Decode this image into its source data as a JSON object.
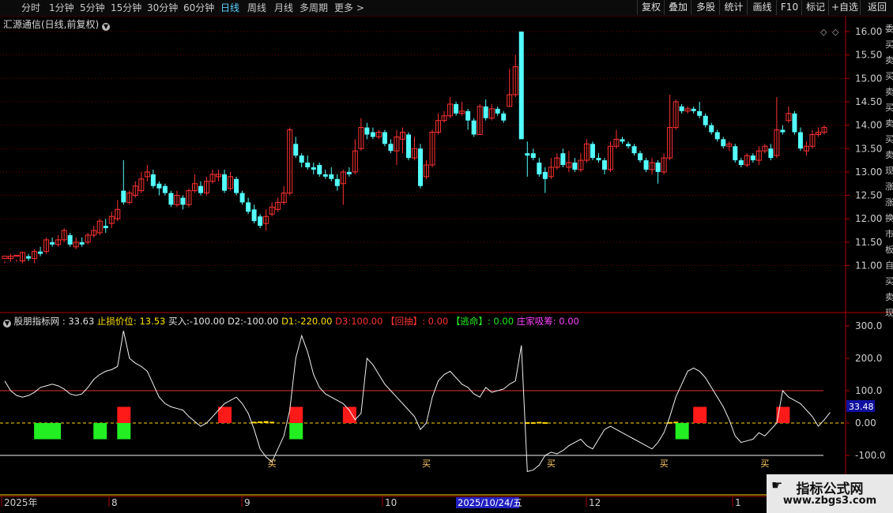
{
  "toolbar": {
    "periods": [
      "分时",
      "1分钟",
      "5分钟",
      "15分钟",
      "30分钟",
      "60分钟",
      "日线",
      "周线",
      "月线",
      "多周期",
      "更多 >"
    ],
    "active_period": "日线",
    "buttons": [
      "复权",
      "叠加",
      "多股",
      "统计",
      "画线",
      "F10",
      "标记",
      "+自选",
      "返回"
    ]
  },
  "main_chart": {
    "title": "汇源通信(日线,前复权)",
    "price_ticks": [
      "16.00",
      "15.50",
      "15.00",
      "14.50",
      "14.00",
      "13.50",
      "13.00",
      "12.50",
      "12.00",
      "11.50",
      "11.00"
    ]
  },
  "indicator": {
    "name": "股朋指标网",
    "value": ": 33.63",
    "stop_label": "止损价位:",
    "stop_value": "13.53",
    "buy_label": "买入:",
    "buy_value": "-100.00",
    "d2": "D2:-100.00",
    "d1": "D1:-220.00",
    "d3": "D3:100.00",
    "huichou_label": "【回抽】",
    "huichou_value": ": 0.00",
    "taoming_label": "【逃命】",
    "taoming_value": ": 0.00",
    "zhuangjia_label": "庄家吸筹:",
    "zhuangjia_value": "0.00",
    "ticks": [
      "300.0",
      "200.0",
      "100.0",
      "0.00",
      "-100.0"
    ],
    "current_badge": "33.48",
    "buy_marker": "买"
  },
  "date_axis": {
    "labels": [
      "2025年",
      "8",
      "9",
      "10",
      "12",
      "1"
    ],
    "cursor_date": "2025/10/24/五"
  },
  "side_text": [
    "委",
    "买",
    "卖",
    "买",
    "卖",
    "买",
    "卖",
    "买",
    "卖",
    "现",
    "涨",
    "涨",
    "换",
    "市",
    "板",
    "自",
    "买",
    "卖",
    "现"
  ],
  "watermark": {
    "line1": "指标公式网",
    "line2": "www.zbgs3.com"
  },
  "colors": {
    "up": "#ff3232",
    "down": "#54ffff",
    "background": "#000000",
    "grid": "#7a0000",
    "axis": "#b00000",
    "signal_red": "#ff1a1a",
    "signal_green": "#22ee22",
    "yellow": "#ffd700"
  },
  "chart_data": {
    "type": "candlestick",
    "candles": [
      [
        11.15,
        11.2,
        11.1,
        11.05
      ],
      [
        11.15,
        11.2,
        11.25,
        11.08
      ],
      [
        11.2,
        11.22,
        11.13,
        11.08
      ],
      [
        11.1,
        11.28,
        11.3,
        11.05
      ],
      [
        11.2,
        11.15,
        11.25,
        11.1
      ],
      [
        11.15,
        11.3,
        11.35,
        11.05
      ],
      [
        11.3,
        11.25,
        11.4,
        11.2
      ],
      [
        11.3,
        11.55,
        11.6,
        11.25
      ],
      [
        11.5,
        11.45,
        11.6,
        11.4
      ],
      [
        11.45,
        11.55,
        11.65,
        11.4
      ],
      [
        11.55,
        11.75,
        11.8,
        11.5
      ],
      [
        11.65,
        11.45,
        11.7,
        11.4
      ],
      [
        11.4,
        11.5,
        11.6,
        11.35
      ],
      [
        11.5,
        11.45,
        11.6,
        11.4
      ],
      [
        11.5,
        11.65,
        11.7,
        11.45
      ],
      [
        11.65,
        11.75,
        11.85,
        11.6
      ],
      [
        11.7,
        11.95,
        12.0,
        11.65
      ],
      [
        11.85,
        11.8,
        12.0,
        11.7
      ],
      [
        11.9,
        12.05,
        12.15,
        11.8
      ],
      [
        12.0,
        12.2,
        12.4,
        11.95
      ],
      [
        12.6,
        12.35,
        13.25,
        12.3
      ],
      [
        12.35,
        12.55,
        12.6,
        12.3
      ],
      [
        12.5,
        12.7,
        12.8,
        12.45
      ],
      [
        12.6,
        12.85,
        13.0,
        12.55
      ],
      [
        12.9,
        13.0,
        13.15,
        12.8
      ],
      [
        12.95,
        12.7,
        13.05,
        12.65
      ],
      [
        12.75,
        12.65,
        12.8,
        12.5
      ],
      [
        12.7,
        12.55,
        12.75,
        12.5
      ],
      [
        12.55,
        12.3,
        12.6,
        12.25
      ],
      [
        12.3,
        12.5,
        12.6,
        12.25
      ],
      [
        12.45,
        12.3,
        12.5,
        12.2
      ],
      [
        12.3,
        12.6,
        12.65,
        12.25
      ],
      [
        12.6,
        12.75,
        12.95,
        12.55
      ],
      [
        12.7,
        12.55,
        12.8,
        12.5
      ],
      [
        12.55,
        12.8,
        12.9,
        12.5
      ],
      [
        12.8,
        12.95,
        13.05,
        12.75
      ],
      [
        12.9,
        12.95,
        13.05,
        12.8
      ],
      [
        12.95,
        12.6,
        13.05,
        12.55
      ],
      [
        12.65,
        12.9,
        13.0,
        12.6
      ],
      [
        12.85,
        12.55,
        12.9,
        12.5
      ],
      [
        12.55,
        12.35,
        12.6,
        12.3
      ],
      [
        12.35,
        12.15,
        12.45,
        12.1
      ],
      [
        12.2,
        11.95,
        12.3,
        11.9
      ],
      [
        12.05,
        11.85,
        12.1,
        11.8
      ],
      [
        11.9,
        12.05,
        12.2,
        11.75
      ],
      [
        12.1,
        12.25,
        12.35,
        12.05
      ],
      [
        12.2,
        12.35,
        12.45,
        12.15
      ],
      [
        12.35,
        12.55,
        12.7,
        12.3
      ],
      [
        12.55,
        13.9,
        13.95,
        12.5
      ],
      [
        13.6,
        13.35,
        13.75,
        13.3
      ],
      [
        13.35,
        13.2,
        13.4,
        13.1
      ],
      [
        13.2,
        13.1,
        13.35,
        13.05
      ],
      [
        13.1,
        13.05,
        13.2,
        12.95
      ],
      [
        13.15,
        12.95,
        13.2,
        12.9
      ],
      [
        12.95,
        12.9,
        13.05,
        12.85
      ],
      [
        12.95,
        12.85,
        13.1,
        12.8
      ],
      [
        12.85,
        12.7,
        12.95,
        12.6
      ],
      [
        12.75,
        13.0,
        13.05,
        12.3
      ],
      [
        13.0,
        12.95,
        13.1,
        12.9
      ],
      [
        13.0,
        13.45,
        13.7,
        12.95
      ],
      [
        13.5,
        13.95,
        14.15,
        13.45
      ],
      [
        13.95,
        13.8,
        14.05,
        13.7
      ],
      [
        13.85,
        13.75,
        13.95,
        13.7
      ],
      [
        13.75,
        13.85,
        13.9,
        13.7
      ],
      [
        13.85,
        13.6,
        13.9,
        13.55
      ],
      [
        13.6,
        13.45,
        13.7,
        13.4
      ],
      [
        13.45,
        13.75,
        13.9,
        13.15
      ],
      [
        13.7,
        13.85,
        13.95,
        13.4
      ],
      [
        13.8,
        13.3,
        13.85,
        13.25
      ],
      [
        13.3,
        13.5,
        13.75,
        13.25
      ],
      [
        13.5,
        12.7,
        13.6,
        12.65
      ],
      [
        12.9,
        13.15,
        13.25,
        12.85
      ],
      [
        13.15,
        13.85,
        13.9,
        13.1
      ],
      [
        13.85,
        14.1,
        14.25,
        13.8
      ],
      [
        14.1,
        14.2,
        14.3,
        14.05
      ],
      [
        14.2,
        14.45,
        14.6,
        14.15
      ],
      [
        14.45,
        14.25,
        14.5,
        14.2
      ],
      [
        14.25,
        14.3,
        14.5,
        14.2
      ],
      [
        14.3,
        14.1,
        14.35,
        13.9
      ],
      [
        14.1,
        13.8,
        14.15,
        13.75
      ],
      [
        13.8,
        14.4,
        14.45,
        13.8
      ],
      [
        14.4,
        14.15,
        14.55,
        14.1
      ],
      [
        14.15,
        14.35,
        14.45,
        14.1
      ],
      [
        14.35,
        14.25,
        14.4,
        14.2
      ],
      [
        14.25,
        14.1,
        14.3,
        14.05
      ],
      [
        14.4,
        14.65,
        15.2,
        14.4
      ],
      [
        14.65,
        15.25,
        15.5,
        14.6
      ],
      [
        16.0,
        13.7,
        16.0,
        13.7
      ],
      [
        13.4,
        13.35,
        13.65,
        12.9
      ],
      [
        13.4,
        13.3,
        13.5,
        13.25
      ],
      [
        13.2,
        12.95,
        13.3,
        12.9
      ],
      [
        13.0,
        12.85,
        13.1,
        12.55
      ],
      [
        12.9,
        13.1,
        13.3,
        12.85
      ],
      [
        13.1,
        13.3,
        13.4,
        13.05
      ],
      [
        13.4,
        13.15,
        13.5,
        13.1
      ],
      [
        13.1,
        13.2,
        13.45,
        13.0
      ],
      [
        13.2,
        13.05,
        13.3,
        13.0
      ],
      [
        13.05,
        13.25,
        13.4,
        13.0
      ],
      [
        13.25,
        13.6,
        13.7,
        13.2
      ],
      [
        13.6,
        13.3,
        13.65,
        13.25
      ],
      [
        13.3,
        13.25,
        13.4,
        13.2
      ],
      [
        13.25,
        13.05,
        13.3,
        12.95
      ],
      [
        13.05,
        13.55,
        13.65,
        13.0
      ],
      [
        13.55,
        13.7,
        13.9,
        13.5
      ],
      [
        13.7,
        13.65,
        13.75,
        13.6
      ],
      [
        13.6,
        13.55,
        13.65,
        13.5
      ],
      [
        13.55,
        13.4,
        13.6,
        13.35
      ],
      [
        13.4,
        13.25,
        13.45,
        13.2
      ],
      [
        13.25,
        13.05,
        13.3,
        13.0
      ],
      [
        13.05,
        13.2,
        13.3,
        12.95
      ],
      [
        13.2,
        13.0,
        13.25,
        12.75
      ],
      [
        13.0,
        13.3,
        13.4,
        12.95
      ],
      [
        13.3,
        13.95,
        14.65,
        13.25
      ],
      [
        13.95,
        14.5,
        14.55,
        13.9
      ],
      [
        14.4,
        14.3,
        14.45,
        14.25
      ],
      [
        14.3,
        14.35,
        14.4,
        14.25
      ],
      [
        14.35,
        14.3,
        14.4,
        14.25
      ],
      [
        14.3,
        14.2,
        14.5,
        14.15
      ],
      [
        14.2,
        14.0,
        14.25,
        13.95
      ],
      [
        14.0,
        13.85,
        14.05,
        13.8
      ],
      [
        13.85,
        13.7,
        13.9,
        13.65
      ],
      [
        13.7,
        13.55,
        13.75,
        13.5
      ],
      [
        13.55,
        13.6,
        13.65,
        13.45
      ],
      [
        13.55,
        13.25,
        13.6,
        13.2
      ],
      [
        13.25,
        13.15,
        13.3,
        13.1
      ],
      [
        13.15,
        13.35,
        13.4,
        13.1
      ],
      [
        13.35,
        13.25,
        13.4,
        13.2
      ],
      [
        13.25,
        13.45,
        13.55,
        13.15
      ],
      [
        13.45,
        13.55,
        13.6,
        13.4
      ],
      [
        13.5,
        13.3,
        13.6,
        13.25
      ],
      [
        13.35,
        13.9,
        14.6,
        13.3
      ],
      [
        13.9,
        13.85,
        14.0,
        13.8
      ],
      [
        14.1,
        14.25,
        14.4,
        14.05
      ],
      [
        14.25,
        13.85,
        14.3,
        13.8
      ],
      [
        13.85,
        13.5,
        13.95,
        13.45
      ],
      [
        13.45,
        13.55,
        13.65,
        13.35
      ],
      [
        13.55,
        13.8,
        13.9,
        13.5
      ],
      [
        13.8,
        13.85,
        13.95,
        13.75
      ],
      [
        13.85,
        13.95,
        14.0,
        13.8
      ]
    ],
    "ylim": [
      10.8,
      16.1
    ],
    "indicator_ylim": [
      -160,
      330
    ],
    "reference_lines": [
      100,
      0,
      -100
    ],
    "indicator_line": [
      130,
      100,
      85,
      80,
      85,
      95,
      110,
      115,
      120,
      115,
      105,
      90,
      85,
      90,
      110,
      135,
      150,
      160,
      165,
      175,
      285,
      200,
      185,
      175,
      160,
      120,
      80,
      60,
      50,
      45,
      40,
      20,
      5,
      -10,
      0,
      20,
      40,
      60,
      70,
      80,
      60,
      30,
      -20,
      -80,
      -105,
      -120,
      -80,
      -40,
      40,
      200,
      270,
      220,
      150,
      110,
      90,
      80,
      70,
      60,
      40,
      10,
      30,
      200,
      180,
      150,
      120,
      100,
      80,
      60,
      40,
      20,
      -20,
      0,
      80,
      130,
      150,
      160,
      140,
      120,
      110,
      90,
      80,
      110,
      95,
      100,
      105,
      120,
      130,
      240,
      -150,
      -145,
      -130,
      -100,
      -90,
      -95,
      -85,
      -70,
      -60,
      -50,
      -70,
      -80,
      -50,
      -20,
      -10,
      -20,
      -30,
      -40,
      -50,
      -60,
      -70,
      -80,
      -60,
      -30,
      20,
      80,
      120,
      160,
      170,
      160,
      140,
      110,
      80,
      50,
      10,
      -40,
      -60,
      -55,
      -50,
      -30,
      -40,
      -20,
      0,
      100,
      80,
      70,
      60,
      40,
      20,
      -10,
      10,
      33
    ],
    "red_signals": [
      20,
      37,
      49,
      58,
      117,
      131
    ],
    "green_signals": [
      6,
      16,
      20,
      49,
      114
    ],
    "buy_markers": [
      45,
      71,
      92,
      111,
      128
    ],
    "yellow_bars": [
      [
        42,
        8
      ],
      [
        43,
        10
      ],
      [
        44,
        12
      ],
      [
        45,
        8
      ],
      [
        88,
        5
      ],
      [
        89,
        5
      ],
      [
        90,
        7
      ],
      [
        91,
        5
      ],
      [
        112,
        6
      ],
      [
        113,
        8
      ]
    ]
  }
}
